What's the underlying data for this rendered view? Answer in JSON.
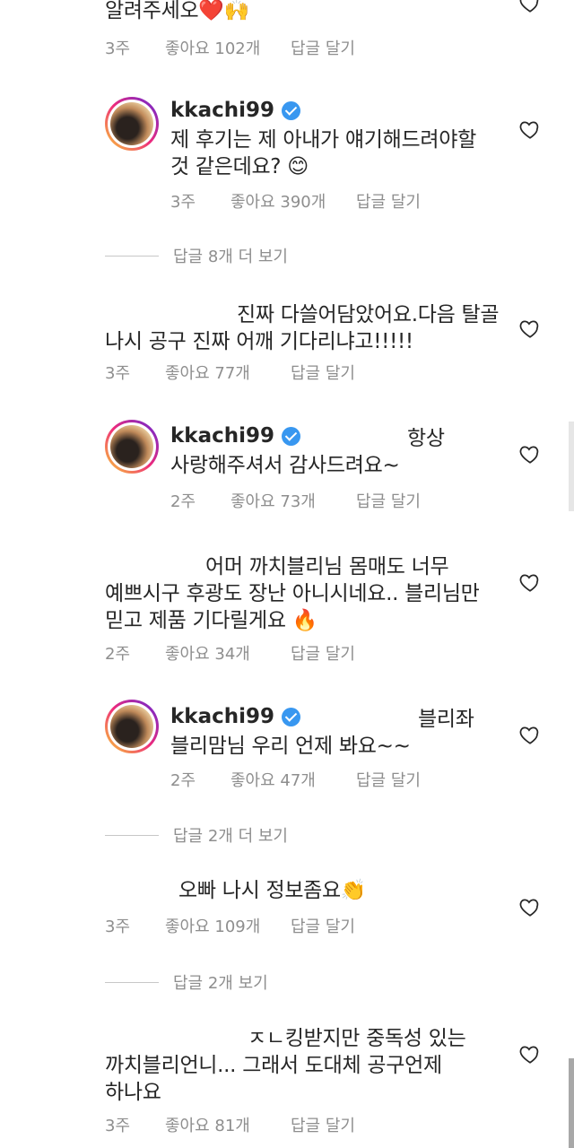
{
  "comments": [
    {
      "id": "c0",
      "text_lines": [
        "알려주세오❤️🙌"
      ],
      "time": "3주",
      "likes": "좋아요 102개",
      "reply": "답글 달기"
    },
    {
      "id": "c1",
      "username": "kkachi99",
      "text_lines": [
        "제 후기는 제 아내가 얘기해드려야할",
        "것 같은데요? 😊"
      ],
      "time": "3주",
      "likes": "좋아요 390개",
      "reply": "답글 달기"
    },
    {
      "id": "more1",
      "more": "답글 8개 더 보기"
    },
    {
      "id": "c2",
      "text_lines": [
        "진짜 다쓸어담았어요.다음 탈골",
        "나시 공구 진짜 어깨 기다리냐고!!!!!"
      ],
      "time": "3주",
      "likes": "좋아요 77개",
      "reply": "답글 달기"
    },
    {
      "id": "c3",
      "username": "kkachi99",
      "text_lines": [
        "항상",
        "사랑해주셔서 감사드려요~"
      ],
      "time": "2주",
      "likes": "좋아요 73개",
      "reply": "답글 달기"
    },
    {
      "id": "c4",
      "text_lines": [
        "어머 까치블리님 몸매도 너무",
        "예쁘시구 후광도 장난 아니시네요.. 블리님만",
        "믿고  제품 기다릴게요 🔥"
      ],
      "time": "2주",
      "likes": "좋아요 34개",
      "reply": "답글 달기"
    },
    {
      "id": "c5",
      "username": "kkachi99",
      "text_lines": [
        "블리좌",
        "블리맘님 우리 언제 봐요~~"
      ],
      "time": "2주",
      "likes": "좋아요 47개",
      "reply": "답글 달기"
    },
    {
      "id": "more2",
      "more": "답글 2개 더 보기"
    },
    {
      "id": "c6",
      "text_lines": [
        "오빠 나시 정보좀요👏"
      ],
      "time": "3주",
      "likes": "좋아요 109개",
      "reply": "답글 달기"
    },
    {
      "id": "more3",
      "more": "답글 2개 보기"
    },
    {
      "id": "c7",
      "text_lines": [
        "ㅈㄴ킹받지만 중독성 있는",
        "까치블리언니... 그래서 도대체 공구언제",
        "하나요"
      ],
      "time": "3주",
      "likes": "좋아요 81개",
      "reply": "답글 달기"
    }
  ],
  "colors": {
    "text": "#262626",
    "muted": "#8e8e8e",
    "verified": "#3897f0"
  }
}
